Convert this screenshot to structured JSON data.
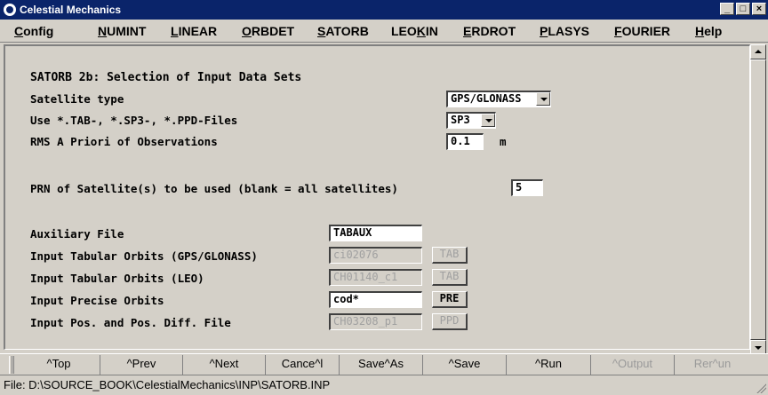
{
  "window": {
    "title": "Celestial Mechanics",
    "controls": [
      "_",
      "□",
      "×"
    ]
  },
  "menu": [
    {
      "label": "Config",
      "key": "C"
    },
    {
      "label": "NUMINT",
      "key": "N"
    },
    {
      "label": "LINEAR",
      "key": "L"
    },
    {
      "label": "ORBDET",
      "key": "O"
    },
    {
      "label": "SATORB",
      "key": "S"
    },
    {
      "label": "LEOKIN",
      "key": "K"
    },
    {
      "label": "ERDROT",
      "key": "E"
    },
    {
      "label": "PLASYS",
      "key": "P"
    },
    {
      "label": "FOURIER",
      "key": "F"
    },
    {
      "label": "Help",
      "key": "H"
    }
  ],
  "panel": {
    "heading": "SATORB 2b: Selection of Input Data Sets",
    "satellite_type": {
      "label": "Satellite type",
      "value": "GPS/GLONASS"
    },
    "file_type": {
      "label": "Use *.TAB-, *.SP3-, *.PPD-Files",
      "value": "SP3"
    },
    "rms": {
      "label": "RMS A Priori of Observations",
      "value": "0.1",
      "unit": "m"
    },
    "prn": {
      "label": "PRN of Satellite(s) to be used (blank = all satellites)",
      "value": "5"
    },
    "aux_file": {
      "label": "Auxiliary File",
      "value": "TABAUX"
    },
    "tab_orbits": {
      "label": "Input Tabular Orbits (GPS/GLONASS)",
      "value": "ci02076",
      "button": "TAB"
    },
    "tab_orbits_leo": {
      "label": "Input Tabular Orbits (LEO)",
      "value": "CH01140_c1",
      "button": "TAB"
    },
    "precise_orbits": {
      "label": "Input Precise Orbits",
      "value": "cod*",
      "button": "PRE"
    },
    "pos_diff": {
      "label": "Input Pos. and Pos. Diff. File",
      "value": "CH03208_p1",
      "button": "PPD"
    }
  },
  "buttons": {
    "top": "^Top",
    "prev": "^Prev",
    "next": "^Next",
    "cancel": "Cance^l",
    "save_as": "Save^As",
    "save": "^Save",
    "run": "^Run",
    "output": "^Output",
    "rerun": "Rer^un"
  },
  "status": "File: D:\\SOURCE_BOOK\\CelestialMechanics\\INP\\SATORB.INP"
}
